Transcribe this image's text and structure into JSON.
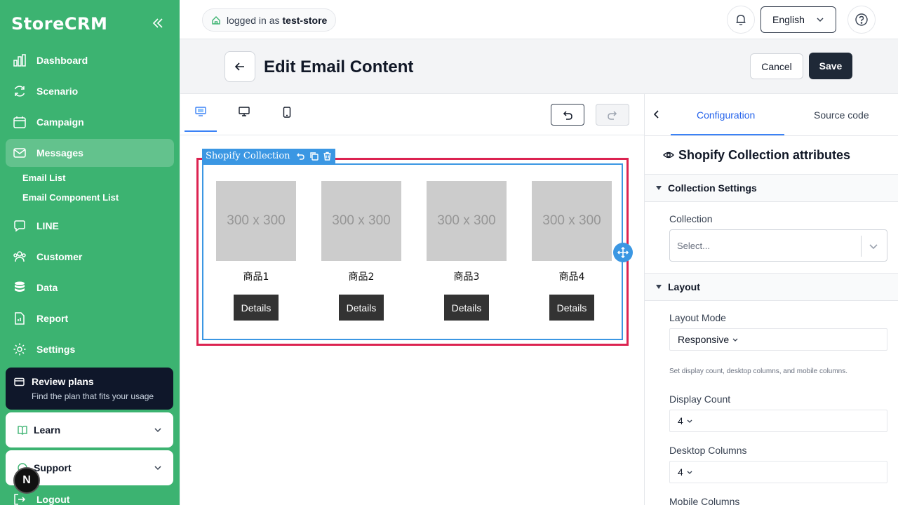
{
  "app": {
    "brand": "StoreCRM"
  },
  "sidebar": {
    "items": [
      {
        "label": "Dashboard",
        "icon": "bar-chart-icon"
      },
      {
        "label": "Scenario",
        "icon": "refresh-icon"
      },
      {
        "label": "Campaign",
        "icon": "calendar-icon"
      },
      {
        "label": "Messages",
        "icon": "mail-icon",
        "active": true
      },
      {
        "label": "LINE",
        "icon": "chat-icon"
      },
      {
        "label": "Customer",
        "icon": "users-icon"
      },
      {
        "label": "Data",
        "icon": "database-icon"
      },
      {
        "label": "Report",
        "icon": "report-icon"
      },
      {
        "label": "Settings",
        "icon": "gear-icon"
      }
    ],
    "sub_items": [
      "Email List",
      "Email Component List"
    ],
    "review": {
      "title": "Review plans",
      "subtitle": "Find the plan that fits your usage"
    },
    "learn": "Learn",
    "support": "Support",
    "logout": "Logout",
    "avatar_letter": "N"
  },
  "topbar": {
    "logged_in_prefix": "logged in as",
    "store": "test-store",
    "language": "English"
  },
  "page": {
    "title": "Edit Email Content",
    "cancel": "Cancel",
    "save": "Save"
  },
  "editor": {
    "block_tag": "Shopify Collection",
    "products": [
      {
        "image": "300 x 300",
        "name": "商品1",
        "button": "Details"
      },
      {
        "image": "300 x 300",
        "name": "商品2",
        "button": "Details"
      },
      {
        "image": "300 x 300",
        "name": "商品3",
        "button": "Details"
      },
      {
        "image": "300 x 300",
        "name": "商品4",
        "button": "Details"
      }
    ]
  },
  "panel": {
    "tabs": [
      "Configuration",
      "Source code"
    ],
    "attributes_title": "Shopify Collection attributes",
    "collection_settings": "Collection Settings",
    "collection_label": "Collection",
    "collection_placeholder": "Select...",
    "layout_section": "Layout",
    "layout_mode_label": "Layout Mode",
    "layout_mode_value": "Responsive",
    "layout_hint": "Set display count, desktop columns, and mobile columns.",
    "display_count_label": "Display Count",
    "display_count_value": "4",
    "desktop_columns_label": "Desktop Columns",
    "desktop_columns_value": "4",
    "mobile_columns_label": "Mobile Columns"
  },
  "colors": {
    "sidebar": "#3cb371",
    "selection": "#dc2351",
    "block": "#3b97e3",
    "primary_dark": "#1f2937"
  }
}
